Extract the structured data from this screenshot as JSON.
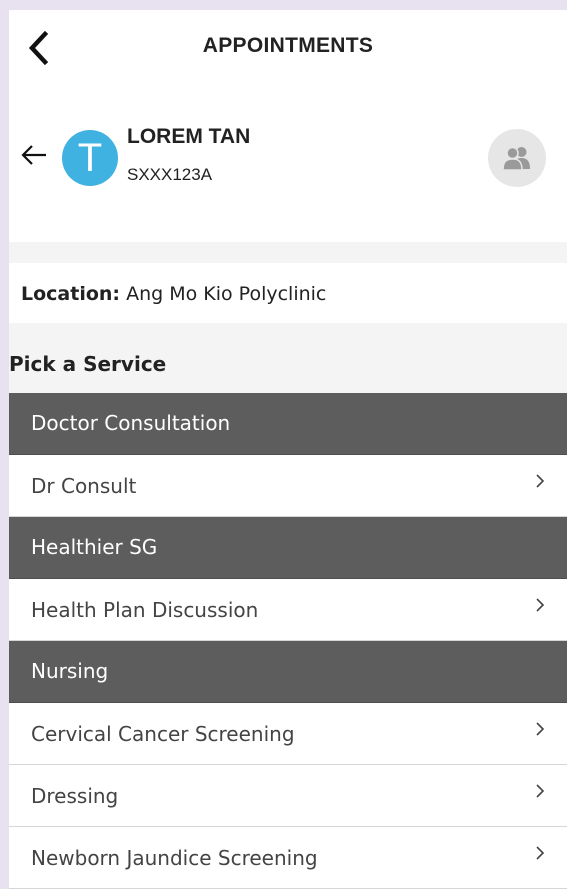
{
  "header": {
    "title": "APPOINTMENTS",
    "back_icon": "chevron-left-icon"
  },
  "profile": {
    "back_icon": "arrow-left-icon",
    "avatar_initial": "T",
    "avatar_color": "#3fb2e2",
    "name": "LOREM TAN",
    "id": "SXXX123A",
    "switch_icon": "users-icon"
  },
  "location": {
    "label": "Location:",
    "value": "Ang Mo Kio Polyclinic"
  },
  "section_title": "Pick a Service",
  "categories": [
    {
      "name": "Doctor Consultation",
      "services": [
        "Dr Consult"
      ]
    },
    {
      "name": "Healthier SG",
      "services": [
        "Health Plan Discussion"
      ]
    },
    {
      "name": "Nursing",
      "services": [
        "Cervical Cancer Screening",
        "Dressing",
        "Newborn Jaundice Screening"
      ]
    }
  ],
  "colors": {
    "category_header": "#5d5d5d",
    "accent": "#3fb2e2"
  }
}
